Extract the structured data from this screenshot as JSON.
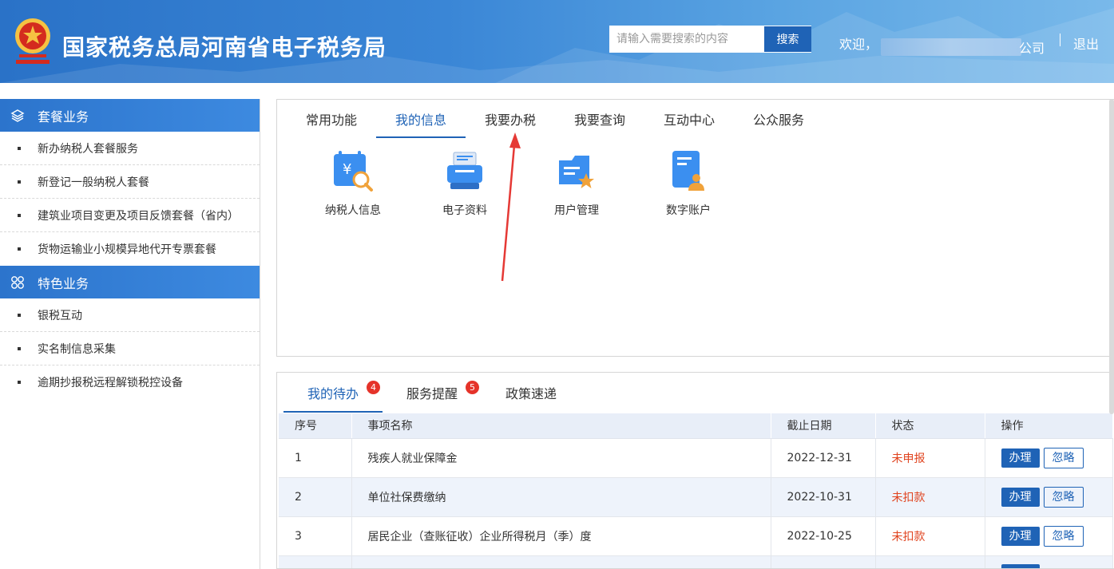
{
  "header": {
    "site_title": "国家税务总局河南省电子税务局",
    "search_placeholder": "请输入需要搜索的内容",
    "search_button": "搜索",
    "welcome": "欢迎，",
    "company_suffix": "公司",
    "logout": "退出"
  },
  "sidebar": {
    "groups": [
      {
        "title": "套餐业务",
        "icon": "layers-icon",
        "items": [
          "新办纳税人套餐服务",
          "新登记一般纳税人套餐",
          "建筑业项目变更及项目反馈套餐（省内）",
          "货物运输业小规模异地代开专票套餐"
        ]
      },
      {
        "title": "特色业务",
        "icon": "grid-circles-icon",
        "items": [
          "银税互动",
          "实名制信息采集",
          "逾期抄报税远程解锁税控设备"
        ]
      }
    ]
  },
  "top_tabs": [
    "常用功能",
    "我的信息",
    "我要办税",
    "我要查询",
    "互动中心",
    "公众服务"
  ],
  "active_top_tab": "我的信息",
  "functions": [
    {
      "label": "纳税人信息",
      "icon": "taxpayer-info-icon"
    },
    {
      "label": "电子资料",
      "icon": "scanner-icon"
    },
    {
      "label": "用户管理",
      "icon": "user-management-icon"
    },
    {
      "label": "数字账户",
      "icon": "digital-account-icon"
    }
  ],
  "bottom_tabs": [
    {
      "label": "我的待办",
      "badge": "4"
    },
    {
      "label": "服务提醒",
      "badge": "5"
    },
    {
      "label": "政策速递",
      "badge": ""
    }
  ],
  "table": {
    "headers": [
      "序号",
      "事项名称",
      "截止日期",
      "状态",
      "操作"
    ],
    "rows": [
      {
        "no": "1",
        "name": "残疾人就业保障金",
        "date": "2022-12-31",
        "status": "未申报"
      },
      {
        "no": "2",
        "name": "单位社保费缴纳",
        "date": "2022-10-31",
        "status": "未扣款"
      },
      {
        "no": "3",
        "name": "居民企业（查账征收）企业所得税月（季）度",
        "date": "2022-10-25",
        "status": "未扣款"
      }
    ],
    "action_do": "办理",
    "action_ignore": "忽略"
  },
  "colors": {
    "brand_blue": "#1f63b6",
    "status_red": "#e0431e",
    "badge_red": "#e5332a"
  }
}
